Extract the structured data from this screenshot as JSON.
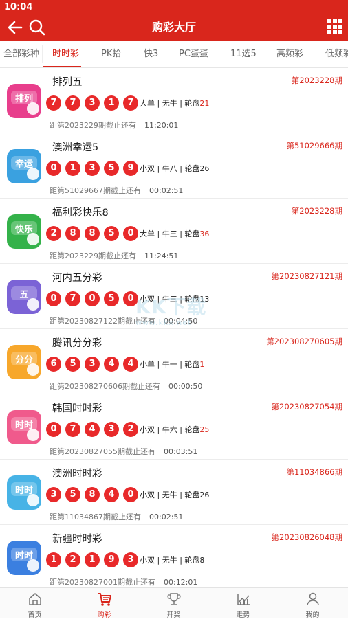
{
  "status": {
    "time": "10:04"
  },
  "header": {
    "title": "购彩大厅"
  },
  "tabs": [
    {
      "label": "全部彩种",
      "active": false
    },
    {
      "label": "时时彩",
      "active": true
    },
    {
      "label": "PK拾",
      "active": false
    },
    {
      "label": "快3",
      "active": false
    },
    {
      "label": "PC蛋蛋",
      "active": false
    },
    {
      "label": "11选5",
      "active": false
    },
    {
      "label": "高频彩",
      "active": false
    },
    {
      "label": "低频彩",
      "active": false
    }
  ],
  "lotteries": [
    {
      "name": "排列五",
      "issue": "第2023228期",
      "balls": [
        "7",
        "7",
        "3",
        "1",
        "7"
      ],
      "meta_a": "大单 | 无牛 | 轮盘",
      "meta_b": "21",
      "meta_b_highlight": true,
      "deadline": "距第2023229期截止还有",
      "countdown": "11:20:01",
      "logo_text": "排列",
      "logo_color": "#e83e8c"
    },
    {
      "name": "澳洲幸运5",
      "issue": "第51029666期",
      "balls": [
        "0",
        "1",
        "3",
        "5",
        "9"
      ],
      "meta_a": "小双 | 牛八 | 轮盘",
      "meta_b": "26",
      "meta_b_highlight": false,
      "deadline": "距第51029667期截止还有",
      "countdown": "00:02:51",
      "logo_text": "幸运",
      "logo_color": "#3aa1e0"
    },
    {
      "name": "福利彩快乐8",
      "issue": "第2023228期",
      "balls": [
        "2",
        "8",
        "8",
        "5",
        "0"
      ],
      "meta_a": "大单 | 牛三 | 轮盘",
      "meta_b": "36",
      "meta_b_highlight": true,
      "deadline": "距第2023229期截止还有",
      "countdown": "11:24:51",
      "logo_text": "快乐",
      "logo_color": "#34b24a"
    },
    {
      "name": "河内五分彩",
      "issue": "第20230827121期",
      "balls": [
        "0",
        "7",
        "0",
        "5",
        "0"
      ],
      "meta_a": "小双 | 牛三 | 轮盘",
      "meta_b": "13",
      "meta_b_highlight": false,
      "deadline": "距第20230827122期截止还有",
      "countdown": "00:04:50",
      "logo_text": "五",
      "logo_color": "#7b63d6"
    },
    {
      "name": "腾讯分分彩",
      "issue": "第20230827060­5期",
      "balls": [
        "6",
        "5",
        "3",
        "4",
        "4"
      ],
      "meta_a": "小单 | 牛一 | 轮盘",
      "meta_b": "1",
      "meta_b_highlight": true,
      "deadline": "距第20230827060­6期截止还有",
      "countdown": "00:00:50",
      "logo_text": "分分",
      "logo_color": "#f7a72b"
    },
    {
      "name": "韩国时时彩",
      "issue": "第20230827054期",
      "balls": [
        "0",
        "7",
        "4",
        "3",
        "2"
      ],
      "meta_a": "小双 | 牛六 | 轮盘",
      "meta_b": "25",
      "meta_b_highlight": true,
      "deadline": "距第20230827055期截止还有",
      "countdown": "00:03:51",
      "logo_text": "时时",
      "logo_color": "#f05a8c"
    },
    {
      "name": "澳洲时时彩",
      "issue": "第11034866期",
      "balls": [
        "3",
        "5",
        "8",
        "4",
        "0"
      ],
      "meta_a": "小双 | 无牛 | 轮盘",
      "meta_b": "26",
      "meta_b_highlight": false,
      "deadline": "距第11034867期截止还有",
      "countdown": "00:02:51",
      "logo_text": "时时",
      "logo_color": "#47b3e6"
    },
    {
      "name": "新疆时时彩",
      "issue": "第20230826048期",
      "balls": [
        "1",
        "2",
        "1",
        "9",
        "3"
      ],
      "meta_a": "小双 | 无牛 | 轮盘",
      "meta_b": "8",
      "meta_b_highlight": false,
      "deadline": "距第20230827001期截止还有",
      "countdown": "00:12:01",
      "logo_text": "时时",
      "logo_color": "#3b7fe0"
    }
  ],
  "bottom_nav": [
    {
      "label": "首页",
      "icon": "home-icon",
      "active": false
    },
    {
      "label": "购彩",
      "icon": "cart-icon",
      "active": true
    },
    {
      "label": "开奖",
      "icon": "trophy-icon",
      "active": false
    },
    {
      "label": "走势",
      "icon": "chart-icon",
      "active": false
    },
    {
      "label": "我的",
      "icon": "user-icon",
      "active": false
    }
  ],
  "watermark": {
    "text": "KK下载",
    "url": "www.kkx.net"
  },
  "colors": {
    "brand": "#d9261c",
    "ball": "#e8292a"
  }
}
